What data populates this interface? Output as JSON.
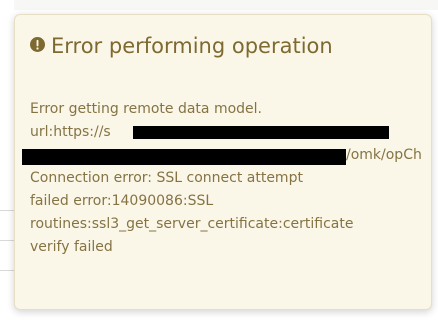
{
  "popover": {
    "title": "Error performing operation",
    "title_icon": "exclamation-circle-icon",
    "lines": {
      "l1": "Error getting remote data model.",
      "l2": "url:https://s",
      "l3": "/omk/opCh",
      "l4": "Connection error: SSL connect attempt",
      "l5": "failed error:14090086:SSL",
      "l6": "routines:ssl3_get_server_certificate:certificate",
      "l7": "verify failed"
    }
  },
  "colors": {
    "popover_bg": "#fbf7e8",
    "title_color": "#7e6a31",
    "text_color": "#857344",
    "redaction": "#000000"
  }
}
